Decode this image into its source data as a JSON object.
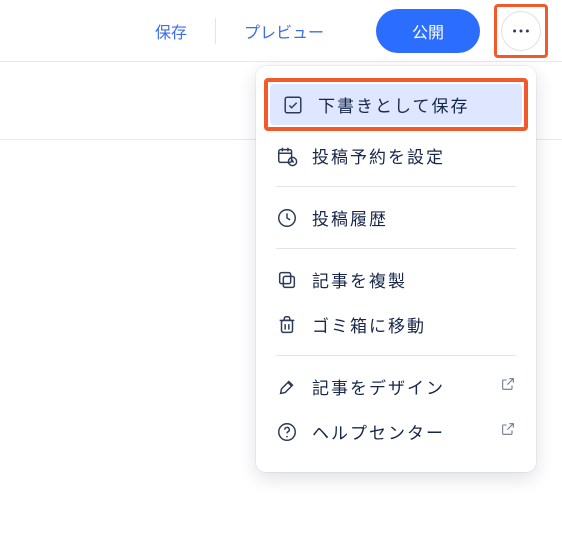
{
  "toolbar": {
    "save_label": "保存",
    "preview_label": "プレビュー",
    "publish_label": "公開"
  },
  "menu": {
    "save_draft": "下書きとして保存",
    "schedule": "投稿予約を設定",
    "history": "投稿履歴",
    "duplicate": "記事を複製",
    "trash": "ゴミ箱に移動",
    "design": "記事をデザイン",
    "help": "ヘルプセンター"
  },
  "highlight": {
    "more_button": true,
    "save_draft_item": true
  }
}
